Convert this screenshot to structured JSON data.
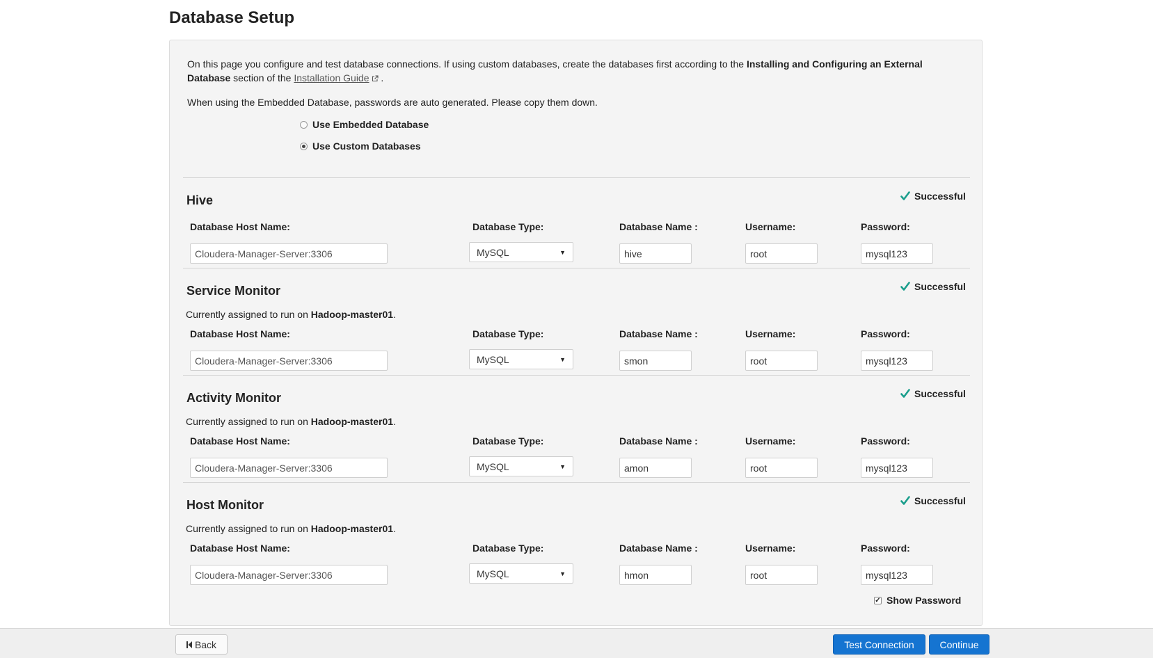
{
  "page": {
    "title": "Database Setup",
    "intro": {
      "text1": "On this page you configure and test database connections. If using custom databases, create the databases first according to the ",
      "bold": "Installing and Configuring an External Database",
      "text2": " section of the ",
      "link": "Installation Guide",
      "text3": " .",
      "line2": "When using the Embedded Database, passwords are auto generated. Please copy them down."
    },
    "db_options": [
      {
        "label": "Use Embedded Database",
        "selected": false
      },
      {
        "label": "Use Custom Databases",
        "selected": true
      }
    ]
  },
  "labels": {
    "host": "Database Host Name:",
    "type": "Database Type:",
    "name": "Database Name :",
    "user": "Username:",
    "pass": "Password:",
    "assigned_prefix": "Currently assigned to run on ",
    "assigned_suffix": "."
  },
  "sections": [
    {
      "title": "Hive",
      "status": "Successful",
      "assigned_host": "",
      "host": "Cloudera-Manager-Server:3306",
      "type": "MySQL",
      "db_name": "hive",
      "username": "root",
      "password": "mysql123"
    },
    {
      "title": "Service Monitor",
      "status": "Successful",
      "assigned_host": "Hadoop-master01",
      "host": "Cloudera-Manager-Server:3306",
      "type": "MySQL",
      "db_name": "smon",
      "username": "root",
      "password": "mysql123"
    },
    {
      "title": "Activity Monitor",
      "status": "Successful",
      "assigned_host": "Hadoop-master01",
      "host": "Cloudera-Manager-Server:3306",
      "type": "MySQL",
      "db_name": "amon",
      "username": "root",
      "password": "mysql123"
    },
    {
      "title": "Host Monitor",
      "status": "Successful",
      "assigned_host": "Hadoop-master01",
      "host": "Cloudera-Manager-Server:3306",
      "type": "MySQL",
      "db_name": "hmon",
      "username": "root",
      "password": "mysql123"
    }
  ],
  "show_password": {
    "label": "Show Password",
    "checked": true
  },
  "footer": {
    "back": "Back",
    "test_connection": "Test Connection",
    "continue": "Continue"
  },
  "colors": {
    "success": "#1a9e8c",
    "primary_button": "#1574d1"
  },
  "icons": {
    "status": "check-icon",
    "back": "skip-back-icon",
    "link": "external-link-icon",
    "select": "caret-down-icon"
  }
}
